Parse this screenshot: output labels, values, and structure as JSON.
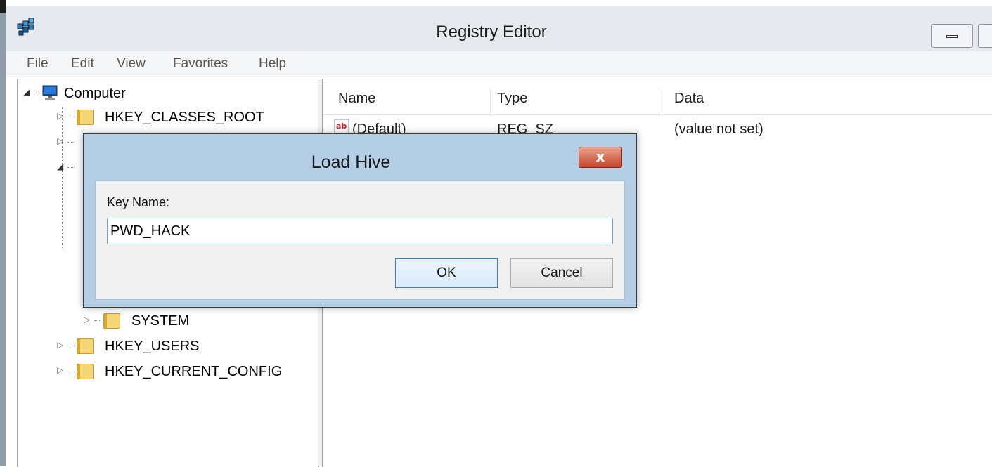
{
  "window": {
    "title": "Registry Editor",
    "app_icon": "regedit-icon"
  },
  "menu": [
    "File",
    "Edit",
    "View",
    "Favorites",
    "Help"
  ],
  "tree": {
    "root": "Computer",
    "items": [
      {
        "label": "HKEY_CLASSES_ROOT"
      },
      {
        "label": "SYSTEM"
      },
      {
        "label": "HKEY_USERS"
      },
      {
        "label": "HKEY_CURRENT_CONFIG"
      }
    ]
  },
  "list": {
    "columns": [
      "Name",
      "Type",
      "Data"
    ],
    "rows": [
      {
        "name": "(Default)",
        "type": "REG_SZ",
        "data": "(value not set)"
      }
    ]
  },
  "dialog": {
    "title": "Load Hive",
    "key_label": "Key Name:",
    "key_value": "PWD_HACK",
    "ok_label": "OK",
    "cancel_label": "Cancel",
    "close_glyph": "x"
  }
}
